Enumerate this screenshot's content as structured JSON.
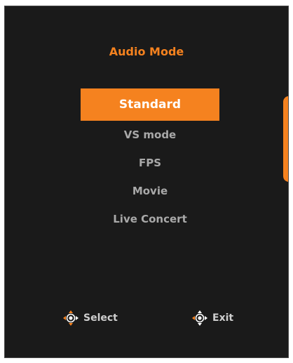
{
  "osd": {
    "title": "Audio Mode",
    "menu": {
      "selected_index": 0,
      "items": [
        {
          "label": "Standard"
        },
        {
          "label": "VS mode"
        },
        {
          "label": "FPS"
        },
        {
          "label": "Movie"
        },
        {
          "label": "Live Concert"
        }
      ]
    },
    "hints": {
      "select_label": "Select",
      "select_icon": "joystick-icon",
      "exit_label": "Exit",
      "exit_icon": "joystick-icon"
    },
    "colors": {
      "accent": "#f5821f",
      "background": "#1a1a1a",
      "item_text": "#a9a9a9",
      "selected_text": "#ffffff"
    }
  }
}
